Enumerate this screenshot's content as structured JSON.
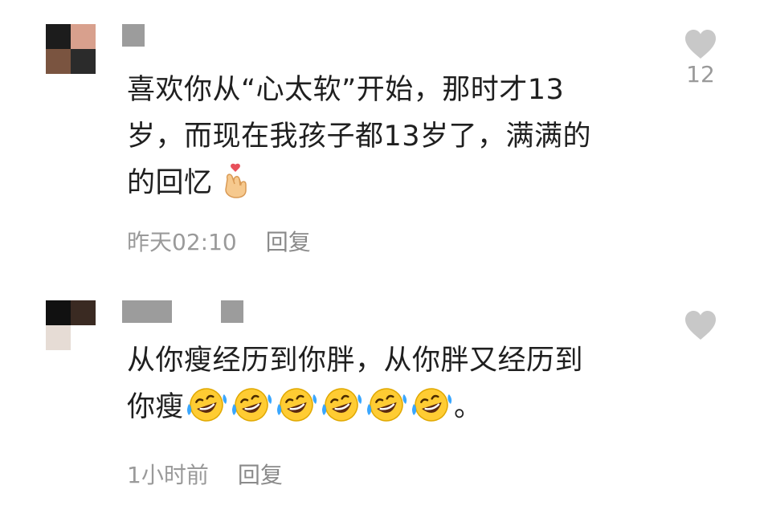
{
  "comments": [
    {
      "text_lines": [
        "喜欢你从“心太软”开始，那时才13",
        "岁，而现在我孩子都13岁了，满满的",
        "的回忆"
      ],
      "emoji": [
        "finger-heart-emoji"
      ],
      "time": "昨天02:10",
      "reply_label": "回复",
      "like_count": "12"
    },
    {
      "text_lines": [
        "从你瘦经历到你胖，从你胖又经历到",
        "你瘦"
      ],
      "emoji": [
        "rolling-laughing-emoji",
        "rolling-laughing-emoji",
        "rolling-laughing-emoji",
        "rolling-laughing-emoji",
        "rolling-laughing-emoji",
        "rolling-laughing-emoji"
      ],
      "trailing_text": "。",
      "time": "1小时前",
      "reply_label": "回复",
      "like_count": ""
    }
  ],
  "colors": {
    "text": "#1f1f1f",
    "meta": "#9a9a9a",
    "heart": "#c8c8c8"
  }
}
